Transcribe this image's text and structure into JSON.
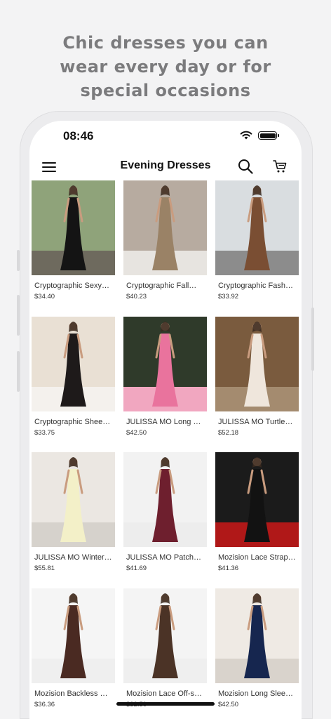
{
  "promo": {
    "line1": "Chic dresses you can",
    "line2": "wear every day or for",
    "line3": "special occasions"
  },
  "status": {
    "time": "08:46"
  },
  "appbar": {
    "title": "Evening Dresses"
  },
  "products": [
    {
      "name": "Cryptographic Sexy…",
      "price": "$34.40",
      "dress": "#141414",
      "bg": "#8fa37a",
      "floor": "#6e6a5e"
    },
    {
      "name": "Cryptographic Fall…",
      "price": "$40.23",
      "dress": "#9a8266",
      "bg": "#b7aba0",
      "floor": "#e7e4e0"
    },
    {
      "name": "Cryptographic Fash…",
      "price": "$33.92",
      "dress": "#7a4e33",
      "bg": "#d9dde0",
      "floor": "#8c8c8c"
    },
    {
      "name": "Cryptographic Shee…",
      "price": "$33.75",
      "dress": "#1e1a1a",
      "bg": "#e9e0d4",
      "floor": "#f4f1ed"
    },
    {
      "name": "JULISSA MO Long S…",
      "price": "$42.50",
      "dress": "#e9739d",
      "bg": "#2f3a2a",
      "floor": "#f1a7c0"
    },
    {
      "name": "JULISSA MO Turtlen…",
      "price": "$52.18",
      "dress": "#efe6dc",
      "bg": "#7a5b3e",
      "floor": "#a48b6f"
    },
    {
      "name": "JULISSA MO Winter…",
      "price": "$55.81",
      "dress": "#f3f0c8",
      "bg": "#ebe7e2",
      "floor": "#d6d2cc"
    },
    {
      "name": "JULISSA MO Patch…",
      "price": "$41.69",
      "dress": "#6e1f2e",
      "bg": "#f2f2f2",
      "floor": "#ededed"
    },
    {
      "name": "Mozision Lace Strap…",
      "price": "$41.36",
      "dress": "#121212",
      "bg": "#1b1b1b",
      "floor": "#b01818"
    },
    {
      "name": "Mozision Backless R…",
      "price": "$36.36",
      "dress": "#4a2a22",
      "bg": "#f5f5f5",
      "floor": "#efefef"
    },
    {
      "name": "Mozision Lace Off-s…",
      "price": "$32.50",
      "dress": "#4b3326",
      "bg": "#f4f4f4",
      "floor": "#efefef"
    },
    {
      "name": "Mozision Long Slee…",
      "price": "$42.50",
      "dress": "#16264f",
      "bg": "#efeae4",
      "floor": "#d9d3cc"
    }
  ]
}
